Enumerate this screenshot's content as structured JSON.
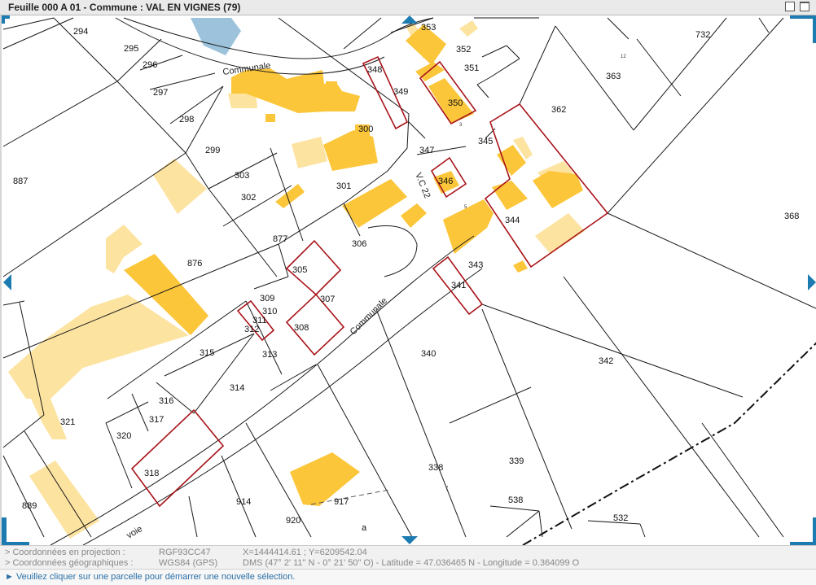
{
  "window": {
    "title": "Feuille 000 A 01 - Commune : VAL EN VIGNES (79)"
  },
  "map": {
    "road_labels": [
      "Communale",
      "Communale",
      "V.C 22",
      "voie"
    ],
    "parcel_numbers": [
      "294",
      "295",
      "296",
      "297",
      "298",
      "299",
      "300",
      "301",
      "302",
      "303",
      "305",
      "306",
      "307",
      "308",
      "309",
      "310",
      "311",
      "312",
      "313",
      "314",
      "315",
      "316",
      "317",
      "318",
      "320",
      "321",
      "338",
      "339",
      "340",
      "341",
      "342",
      "343",
      "344",
      "345",
      "346",
      "347",
      "348",
      "349",
      "350",
      "351",
      "352",
      "353",
      "362",
      "363",
      "368",
      "538",
      "532",
      "732",
      "876",
      "877",
      "887",
      "889",
      "914",
      "917",
      "920",
      "a"
    ],
    "small_numbers": [
      "12",
      "5",
      "7",
      "3"
    ],
    "colors": {
      "building_dark": "#fcc63a",
      "building_light": "#fde3a0",
      "water": "#9cc3db",
      "selected_outline": "#a8141a",
      "accent": "#1c7bb0"
    }
  },
  "footer": {
    "projection_label": "> Coordonnées en projection :",
    "projection_system": "RGF93CC47",
    "projection_value": "X=1444414.61 ; Y=6209542.04",
    "geo_label": "> Coordonnées géographiques :",
    "geo_system": "WGS84 (GPS)",
    "geo_value": "DMS (47° 2' 11\" N - 0° 21' 50\" O) - Latitude = 47.036465 N - Longitude = 0.364099 O"
  },
  "info": {
    "message": "► Veuillez cliquer sur une parcelle pour démarrer une nouvelle sélection."
  }
}
